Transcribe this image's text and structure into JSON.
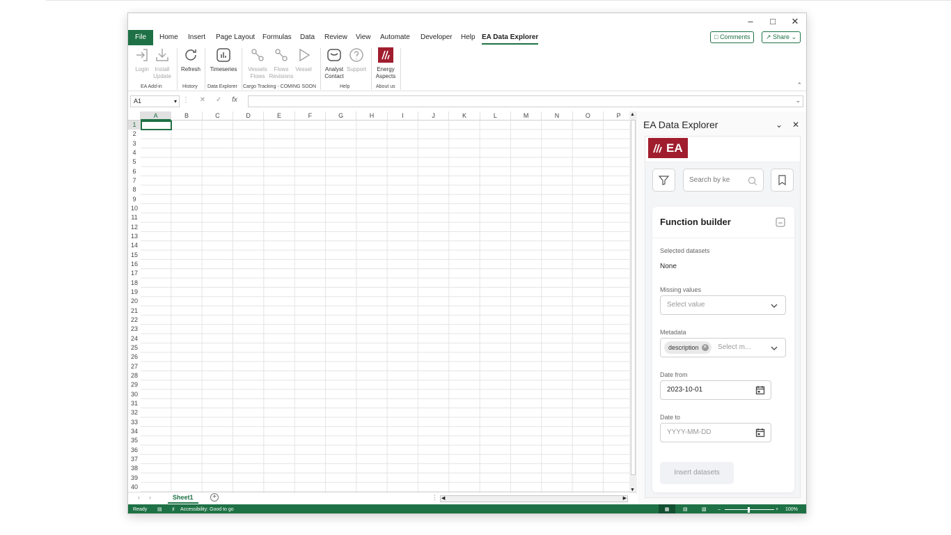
{
  "menu": {
    "file": "File",
    "tabs": [
      "Home",
      "Insert",
      "Page Layout",
      "Formulas",
      "Data",
      "Review",
      "View",
      "Automate",
      "Developer",
      "Help"
    ],
    "active_tab": "EA Data Explorer",
    "comments_label": "Comments",
    "share_label": "Share"
  },
  "ribbon": {
    "buttons": {
      "login": [
        "Login",
        ""
      ],
      "install": [
        "Install",
        "Update"
      ],
      "refresh": [
        "Refresh",
        ""
      ],
      "timeseries": [
        "Timeseries",
        ""
      ],
      "vessels": [
        "Vessels",
        "Flows"
      ],
      "flows": [
        "Flows",
        "Revisions"
      ],
      "vessel": [
        "Vessel",
        ""
      ],
      "analyst": [
        "Analyst",
        "Contact"
      ],
      "support": [
        "Support",
        ""
      ],
      "energy": [
        "Energy",
        "Aspects"
      ]
    },
    "groups": {
      "ea_addin": "EA Add-in",
      "history": "History",
      "data_explorer": "Data Explorer",
      "cargo": "Cargo Tracking - COMING SOON",
      "help": "Help",
      "about": "About us"
    }
  },
  "formula_bar": {
    "name_box": "A1",
    "fx": "fx"
  },
  "grid": {
    "columns": [
      "A",
      "B",
      "C",
      "D",
      "E",
      "F",
      "G",
      "H",
      "I",
      "J",
      "K",
      "L",
      "M",
      "N",
      "O",
      "P"
    ],
    "rows": [
      "1",
      "2",
      "3",
      "4",
      "5",
      "6",
      "7",
      "8",
      "9",
      "10",
      "11",
      "12",
      "13",
      "14",
      "15",
      "16",
      "17",
      "18",
      "19",
      "20",
      "21",
      "22",
      "23",
      "24",
      "25",
      "26",
      "27",
      "28",
      "29",
      "30",
      "31",
      "32",
      "33",
      "34",
      "35",
      "36",
      "37",
      "38",
      "39",
      "40"
    ],
    "selected_cell": "A1"
  },
  "sheet": {
    "tab": "Sheet1"
  },
  "status": {
    "ready": "Ready",
    "accessibility": "Accessibility: Good to go",
    "zoom": "100%"
  },
  "pane": {
    "title": "EA Data Explorer",
    "logo_text": "EA",
    "search_placeholder": "Search by ke",
    "card_title": "Function builder",
    "selected_label": "Selected datasets",
    "selected_value": "None",
    "missing_label": "Missing values",
    "missing_placeholder": "Select value",
    "metadata_label": "Metadata",
    "metadata_chip": "description",
    "metadata_placeholder": "Select m...",
    "date_from_label": "Date from",
    "date_from_value": "2023-10-01",
    "date_to_label": "Date to",
    "date_to_placeholder": "YYYY-MM-DD",
    "insert_label": "Insert datasets"
  },
  "colors": {
    "excel_green": "#1e7145",
    "ea_red": "#a01d2e"
  }
}
